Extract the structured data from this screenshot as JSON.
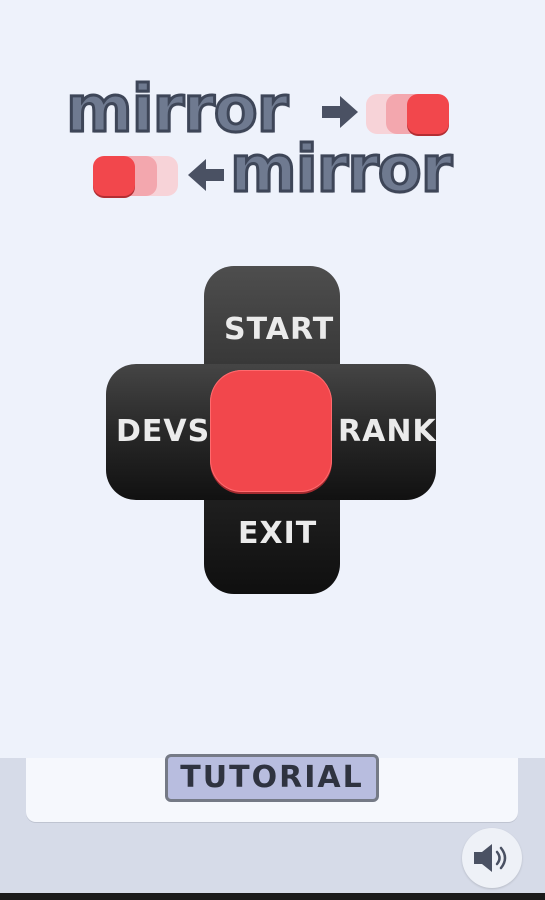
{
  "logo": {
    "line1": "mirror",
    "line2": "mirror"
  },
  "colors": {
    "background": "#eef2fb",
    "accent_red": "#f2474c",
    "logo_text": "#6f7a90",
    "dpad_dark": "#1e1e1e",
    "tutorial_bg": "#b8bddf"
  },
  "menu": {
    "up": "START",
    "left": "DEVS",
    "right": "RANK",
    "down": "EXIT"
  },
  "tutorial_label": "TUTORIAL",
  "icons": {
    "arrow_right": "arrow-right-icon",
    "arrow_left": "arrow-left-icon",
    "sound": "speaker-icon"
  }
}
